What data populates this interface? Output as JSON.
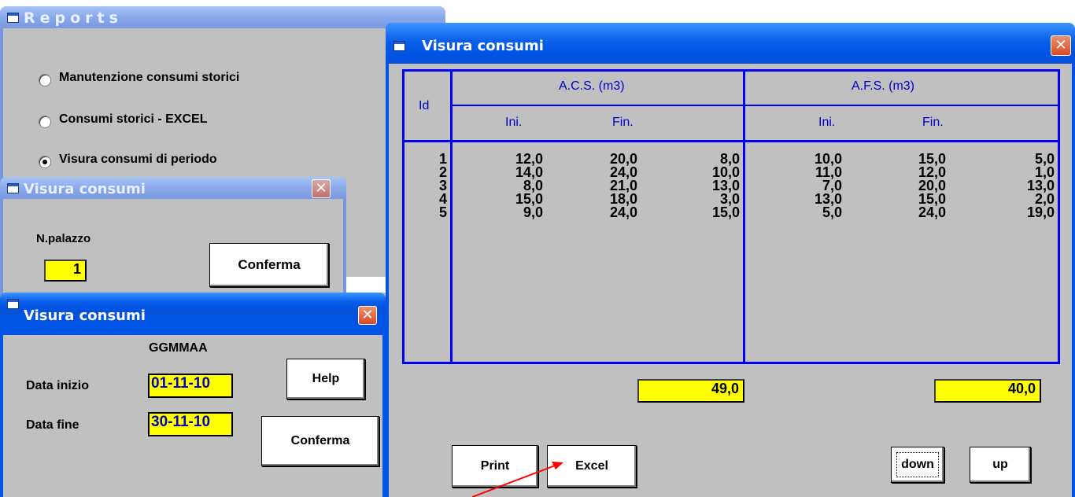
{
  "reports_window": {
    "title": "Reports",
    "options": [
      {
        "label": "Manutenzione consumi storici",
        "selected": false
      },
      {
        "label": "Consumi storici - EXCEL",
        "selected": false
      },
      {
        "label": "Visura consumi di periodo",
        "selected": true
      }
    ]
  },
  "palazzo_window": {
    "title": "Visura consumi",
    "field_label": "N.palazzo",
    "field_value": "1",
    "confirm_label": "Conferma",
    "close_glyph": "✕"
  },
  "date_window": {
    "title": "Visura consumi",
    "format_label": "GGMMAA",
    "start_label": "Data inizio",
    "start_value": "01-11-10",
    "end_label": "Data fine",
    "end_value": "30-11-10",
    "help_label": "Help",
    "confirm_label": "Conferma",
    "close_glyph": "✕"
  },
  "main_window": {
    "title": "Visura consumi",
    "close_glyph": "✕",
    "table": {
      "id_header": "Id",
      "acs_header": "A.C.S.  (m3)",
      "afs_header": "A.F.S.  (m3)",
      "ini_label": "Ini.",
      "fin_label": "Fin.",
      "ids": [
        "1",
        "2",
        "3",
        "4",
        "5"
      ],
      "acs_ini": [
        "12,0",
        "14,0",
        "8,0",
        "15,0",
        "9,0"
      ],
      "acs_fin": [
        "20,0",
        "24,0",
        "21,0",
        "18,0",
        "24,0"
      ],
      "acs_diff": [
        "8,0",
        "10,0",
        "13,0",
        "3,0",
        "15,0"
      ],
      "afs_ini": [
        "10,0",
        "11,0",
        "7,0",
        "13,0",
        "5,0"
      ],
      "afs_fin": [
        "15,0",
        "12,0",
        "20,0",
        "15,0",
        "24,0"
      ],
      "afs_diff": [
        "5,0",
        "1,0",
        "13,0",
        "2,0",
        "19,0"
      ]
    },
    "acs_total": "49,0",
    "afs_total": "40,0",
    "buttons": {
      "print": "Print",
      "excel": "Excel",
      "down": "down",
      "up": "up"
    }
  },
  "colors": {
    "titlebar_active": "#0054e3",
    "grid_lines": "#0000ff",
    "total_box": "#ffff00",
    "arrow": "#ff0000"
  }
}
